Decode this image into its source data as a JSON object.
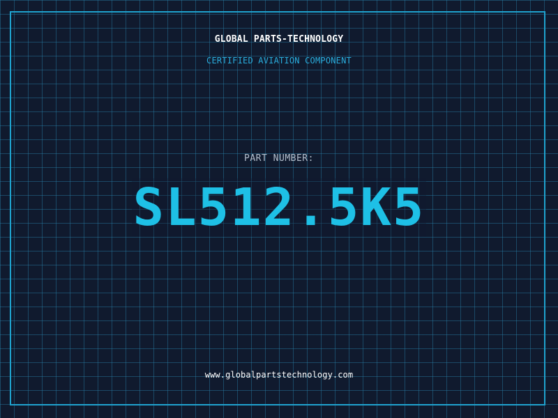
{
  "header": {
    "company": "GLOBAL PARTS-TECHNOLOGY",
    "subtitle": "CERTIFIED AVIATION COMPONENT"
  },
  "part": {
    "label": "PART NUMBER:",
    "number": "SL512.5K5"
  },
  "footer": {
    "website": "www.globalpartstechnology.com"
  },
  "colors": {
    "background": "#101a2e",
    "grid": "#2882aa",
    "accent": "#1fa3cf",
    "part_number": "#1ec0e6",
    "label": "#b4bfcd",
    "text": "#ffffff"
  }
}
